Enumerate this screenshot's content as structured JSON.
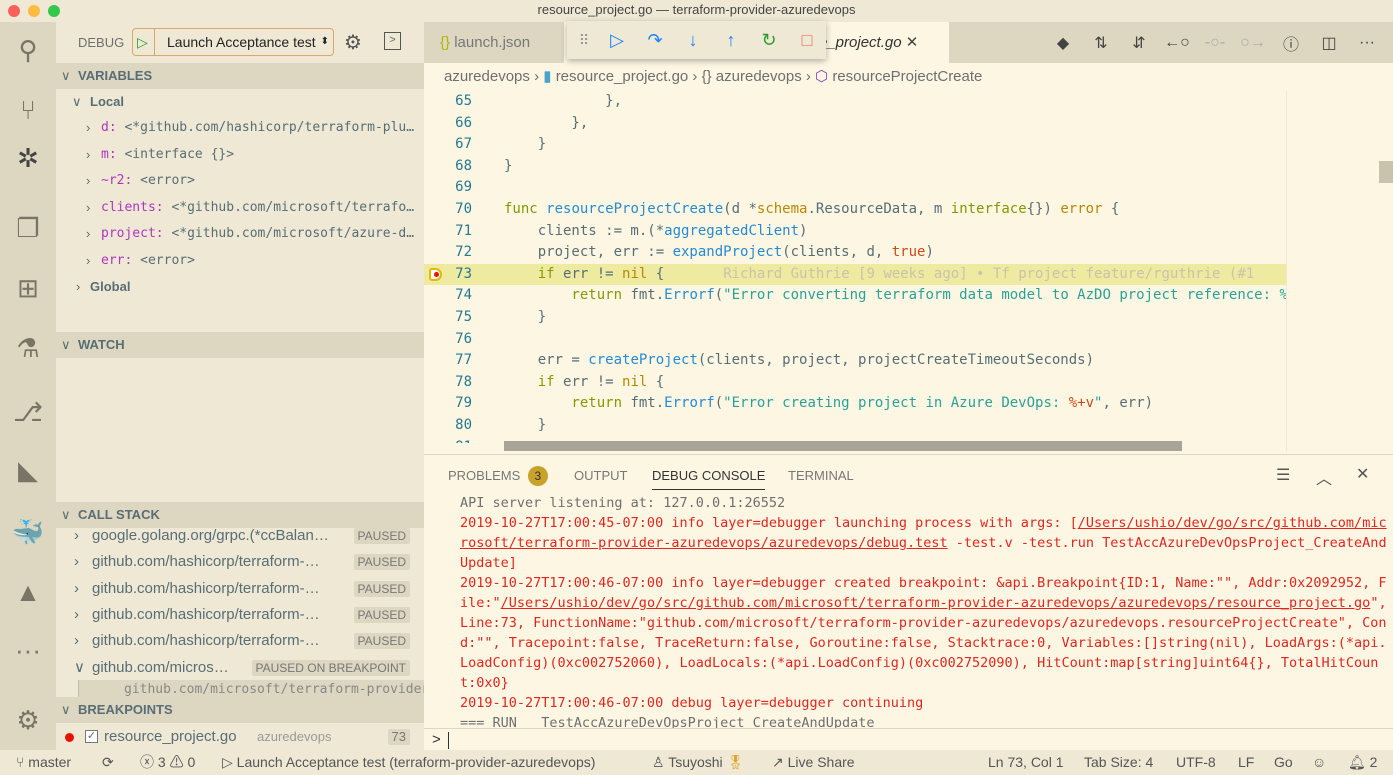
{
  "window": {
    "title": "resource_project.go — terraform-provider-azuredevops"
  },
  "colors": {
    "background": "#fdf6e3",
    "sidebar": "#eee8d5",
    "activity_bar": "#ddd6c1",
    "breakpoint": "#e51400",
    "console_error": "#e0261f"
  },
  "activity_bar": [
    {
      "icon": "search-icon",
      "glyph": "⚲"
    },
    {
      "icon": "source-control-icon",
      "glyph": "⑂"
    },
    {
      "icon": "debug-icon",
      "glyph": "✲"
    },
    {
      "icon": "explorer-icon",
      "glyph": "❐"
    },
    {
      "icon": "extensions-icon",
      "glyph": "⊞"
    },
    {
      "icon": "test-flask-icon",
      "glyph": "⚗"
    },
    {
      "icon": "git-graph-icon",
      "glyph": "⎇"
    },
    {
      "icon": "terraform-icon",
      "glyph": "◣"
    },
    {
      "icon": "docker-icon",
      "glyph": "🐳"
    },
    {
      "icon": "azure-icon",
      "glyph": "▲"
    },
    {
      "icon": "more-icon",
      "glyph": "···"
    },
    {
      "icon": "settings-gear-icon",
      "glyph": "⚙"
    }
  ],
  "debug": {
    "label": "DEBUG",
    "config": "Launch Acceptance test"
  },
  "variables": {
    "header": "VARIABLES",
    "local_label": "Local",
    "global_label": "Global",
    "items": [
      {
        "name": "d:",
        "value": "<*github.com/hashicorp/terraform-plu…"
      },
      {
        "name": "m:",
        "value": "<interface {}>"
      },
      {
        "name": "~r2:",
        "value": "<error>"
      },
      {
        "name": "clients:",
        "value": "<*github.com/microsoft/terrafo…"
      },
      {
        "name": "project:",
        "value": "<*github.com/microsoft/azure-d…"
      },
      {
        "name": "err:",
        "value": "<error>"
      }
    ]
  },
  "watch": {
    "header": "WATCH"
  },
  "call_stack": {
    "header": "CALL STACK",
    "frames": [
      {
        "name": "google.golang.org/grpc.(*ccBalan…",
        "status": "PAUSED"
      },
      {
        "name": "github.com/hashicorp/terraform-…",
        "status": "PAUSED"
      },
      {
        "name": "github.com/hashicorp/terraform-…",
        "status": "PAUSED"
      },
      {
        "name": "github.com/hashicorp/terraform-…",
        "status": "PAUSED"
      },
      {
        "name": "github.com/hashicorp/terraform-…",
        "status": "PAUSED"
      },
      {
        "name": "github.com/micros…",
        "status": "PAUSED ON BREAKPOINT"
      }
    ],
    "sub_frame": "github.com/microsoft/terraform-provider-azuredevops"
  },
  "breakpoints": {
    "header": "BREAKPOINTS",
    "items": [
      {
        "file": "resource_project.go",
        "folder": "azuredevops",
        "line": "73",
        "checked": true
      }
    ]
  },
  "tabs": [
    {
      "label": "launch.json",
      "icon": "{}"
    },
    {
      "label": "resource_project.go",
      "visible_label": "e_project.go",
      "active": true
    }
  ],
  "debug_toolbar": [
    {
      "icon": "drag-handle-icon",
      "glyph": "⠿"
    },
    {
      "icon": "continue-icon",
      "glyph": "▷"
    },
    {
      "icon": "step-over-icon",
      "glyph": "↷"
    },
    {
      "icon": "step-into-icon",
      "glyph": "↓"
    },
    {
      "icon": "step-out-icon",
      "glyph": "↑"
    },
    {
      "icon": "restart-icon",
      "glyph": "↻"
    },
    {
      "icon": "stop-icon",
      "glyph": "□"
    }
  ],
  "editor_actions": [
    {
      "icon": "git-lens-icon",
      "glyph": "◆"
    },
    {
      "icon": "compare-changes-icon",
      "glyph": "⇅"
    },
    {
      "icon": "open-changes-icon",
      "glyph": "⇵"
    },
    {
      "icon": "previous-revision-icon",
      "glyph": "←○"
    },
    {
      "icon": "current-revision-icon",
      "glyph": "-○-"
    },
    {
      "icon": "next-revision-icon",
      "glyph": "○→"
    },
    {
      "icon": "git-graph-icon",
      "glyph": "ⓘ"
    },
    {
      "icon": "split-editor-icon",
      "glyph": "◫"
    },
    {
      "icon": "more-actions-icon",
      "glyph": "···"
    }
  ],
  "breadcrumb": [
    "azuredevops",
    "resource_project.go",
    "{} azuredevops",
    "resourceProjectCreate"
  ],
  "code": [
    {
      "n": "65",
      "t": [
        [
          "            },",
          ""
        ]
      ]
    },
    {
      "n": "66",
      "t": [
        [
          "        },",
          ""
        ]
      ]
    },
    {
      "n": "67",
      "t": [
        [
          "    }",
          ""
        ]
      ]
    },
    {
      "n": "68",
      "t": [
        [
          "}",
          ""
        ]
      ]
    },
    {
      "n": "69",
      "t": []
    },
    {
      "n": "70",
      "t": [
        [
          "func ",
          "k"
        ],
        [
          "resourceProjectCreate",
          "f"
        ],
        [
          "(d *",
          ""
        ],
        [
          "schema",
          "t"
        ],
        [
          ".ResourceData, m ",
          ""
        ],
        [
          "interface",
          "k"
        ],
        [
          "{}) ",
          ""
        ],
        [
          "error",
          "t"
        ],
        [
          " {",
          ""
        ]
      ]
    },
    {
      "n": "71",
      "t": [
        [
          "    clients := m.(*",
          "f"
        ],
        [
          "aggregatedClient",
          ""
        ],
        [
          ")",
          ""
        ]
      ]
    },
    {
      "n": "72",
      "t": [
        [
          "    project, err := ",
          "f"
        ],
        [
          "expandProject",
          ""
        ],
        [
          "(clients, d, ",
          ""
        ],
        [
          "true",
          "b"
        ],
        [
          ")",
          ""
        ]
      ]
    },
    {
      "n": "73",
      "t": [
        [
          "    if ",
          "k"
        ],
        [
          "err != ",
          ""
        ],
        [
          "nil",
          "t"
        ],
        [
          " {",
          ""
        ],
        [
          "       Richard Guthrie [9 weeks ago] • Tf project feature/rguthrie (#1",
          "blame"
        ]
      ],
      "hl": true,
      "bp": true
    },
    {
      "n": "74",
      "t": [
        [
          "        return ",
          "k"
        ],
        [
          "fmt.",
          ""
        ],
        [
          "Errorf",
          "f"
        ],
        [
          "(",
          ""
        ],
        [
          "\"Error converting terraform data model to AzDO project reference: %+v\"",
          "s"
        ]
      ]
    },
    {
      "n": "75",
      "t": [
        [
          "    }",
          ""
        ]
      ]
    },
    {
      "n": "76",
      "t": []
    },
    {
      "n": "77",
      "t": [
        [
          "    err = ",
          "f"
        ],
        [
          "createProject",
          ""
        ],
        [
          "(clients, project, projectCreateTimeoutSeconds)",
          ""
        ]
      ]
    },
    {
      "n": "78",
      "t": [
        [
          "    if ",
          "k"
        ],
        [
          "err != ",
          ""
        ],
        [
          "nil",
          "t"
        ],
        [
          " {",
          ""
        ]
      ]
    },
    {
      "n": "79",
      "t": [
        [
          "        return ",
          "k"
        ],
        [
          "fmt.",
          ""
        ],
        [
          "Errorf",
          "f"
        ],
        [
          "(",
          ""
        ],
        [
          "\"Error creating project in Azure DevOps: ",
          "s"
        ],
        [
          "%+v",
          "b"
        ],
        [
          "\"",
          "s"
        ],
        [
          ", err)",
          ""
        ]
      ]
    },
    {
      "n": "80",
      "t": [
        [
          "    }",
          ""
        ]
      ]
    },
    {
      "n": "81",
      "t": []
    }
  ],
  "panel": {
    "tabs": [
      "PROBLEMS",
      "OUTPUT",
      "DEBUG CONSOLE",
      "TERMINAL"
    ],
    "problems_count": "3",
    "active": "DEBUG CONSOLE"
  },
  "console": [
    {
      "cls": "gray",
      "seg": [
        [
          "API server listening at: 127.0.0.1:26552",
          ""
        ]
      ]
    },
    {
      "cls": "",
      "seg": [
        [
          "2019-10-27T17:00:45-07:00 info layer=debugger launching process with args: [",
          ""
        ],
        [
          "/Users/ushio/dev/go/src/github.com/microsoft/terraform-provider-azuredevops/azuredevops/debug.test",
          "link"
        ],
        [
          " -test.v -test.run TestAccAzureDevOpsProject_CreateAndUpdate]",
          ""
        ]
      ]
    },
    {
      "cls": "",
      "seg": [
        [
          "2019-10-27T17:00:46-07:00 info layer=debugger created breakpoint: &api.Breakpoint{ID:1, Name:\"\", Addr:0x2092952, File:\"",
          ""
        ],
        [
          "/Users/ushio/dev/go/src/github.com/microsoft/terraform-provider-azuredevops/azuredevops/resource_project.go",
          "link"
        ],
        [
          "\", Line:73, FunctionName:\"github.com/microsoft/terraform-provider-azuredevops/azuredevops.resourceProjectCreate\", Cond:\"\", Tracepoint:false, TraceReturn:false, Goroutine:false, Stacktrace:0, Variables:[]string(nil), LoadArgs:(*api.LoadConfig)(0xc002752060), LoadLocals:(*api.LoadConfig)(0xc002752090), HitCount:map[string]uint64{}, TotalHitCount:0x0}",
          ""
        ]
      ]
    },
    {
      "cls": "",
      "seg": [
        [
          "2019-10-27T17:00:46-07:00 debug layer=debugger continuing",
          ""
        ]
      ]
    },
    {
      "cls": "gray",
      "seg": [
        [
          "=== RUN   TestAccAzureDevOpsProject_CreateAndUpdate",
          ""
        ]
      ]
    }
  ],
  "console_prompt": ">",
  "status": {
    "branch": "master",
    "errors": "3",
    "warnings": "0",
    "launch": "Launch Acceptance test (terraform-provider-azuredevops)",
    "user": "Tsuyoshi",
    "live_share": "Live Share",
    "position": "Ln 73, Col 1",
    "tab_size": "Tab Size: 4",
    "encoding": "UTF-8",
    "eol": "LF",
    "language": "Go",
    "notifications": "2"
  }
}
